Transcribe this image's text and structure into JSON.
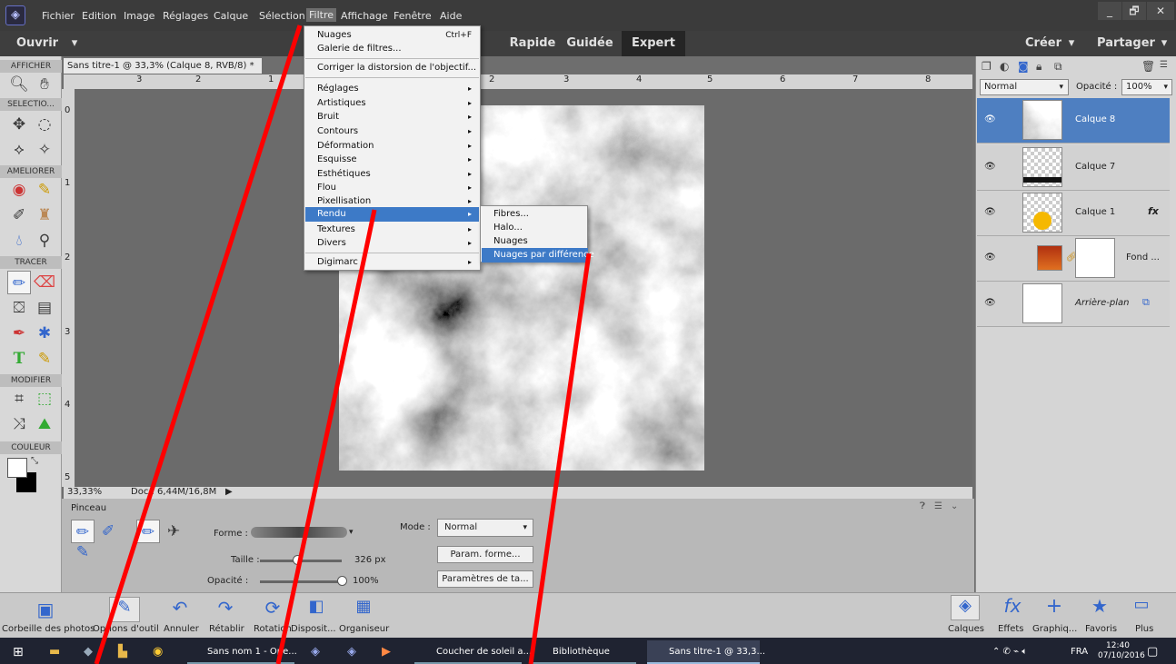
{
  "menubar": {
    "items": [
      "Fichier",
      "Edition",
      "Image",
      "Réglages",
      "Calque",
      "Sélection",
      "Filtre",
      "Affichage",
      "Fenêtre",
      "Aide"
    ],
    "selected": "Filtre",
    "window_controls": [
      "_",
      "🗗",
      "✕"
    ]
  },
  "modebar": {
    "open_label": "Ouvrir",
    "open_arrow": "▾",
    "modes": [
      "Rapide",
      "Guidée",
      "Expert"
    ],
    "active_mode": "Expert",
    "create_label": "Créer",
    "share_label": "Partager",
    "dropdown_arrow": "▾"
  },
  "toolbox": {
    "sections": [
      "AFFICHER",
      "SELECTIO...",
      "AMELIORER",
      "TRACER",
      "MODIFIER",
      "COULEUR"
    ]
  },
  "document": {
    "tab_title": "Sans titre-1 @ 33,3% (Calque 8, RVB/8) *",
    "tab_close": "×",
    "zoom": "33,33%",
    "doc_size": "Doc : 6,44M/16,8M",
    "ruler_h": [
      "3",
      "2",
      "1",
      "2",
      "3",
      "4",
      "5",
      "6",
      "7",
      "8"
    ],
    "ruler_v": [
      "0",
      "1",
      "2",
      "3",
      "4",
      "5"
    ]
  },
  "filter_menu": {
    "items": [
      {
        "label": "Nuages",
        "shortcut": "Ctrl+F"
      },
      {
        "label": "Galerie de filtres..."
      },
      {
        "label": "Corriger la distorsion de l'objectif..."
      },
      {
        "label": "Réglages",
        "sub": true
      },
      {
        "label": "Artistiques",
        "sub": true
      },
      {
        "label": "Bruit",
        "sub": true
      },
      {
        "label": "Contours",
        "sub": true
      },
      {
        "label": "Déformation",
        "sub": true
      },
      {
        "label": "Esquisse",
        "sub": true
      },
      {
        "label": "Esthétiques",
        "sub": true
      },
      {
        "label": "Flou",
        "sub": true
      },
      {
        "label": "Pixellisation",
        "sub": true
      },
      {
        "label": "Rendu",
        "sub": true,
        "highlighted": true
      },
      {
        "label": "Textures",
        "sub": true
      },
      {
        "label": "Divers",
        "sub": true
      },
      {
        "label": "Digimarc",
        "sub": true
      }
    ],
    "arrow": "▸",
    "highlighted": "Rendu"
  },
  "render_submenu": {
    "items": [
      "Fibres...",
      "Halo...",
      "Nuages",
      "Nuages par différence"
    ],
    "highlighted": "Nuages par différence"
  },
  "options": {
    "tool_name": "Pinceau",
    "forme_label": "Forme :",
    "mode_label": "Mode :",
    "mode_value": "Normal",
    "size_label": "Taille :",
    "size_value": "326 px",
    "size_level": 0.45,
    "opacity_label": "Opacité :",
    "opacity_value": "100%",
    "opacity_level": 1.0,
    "btn_brush_settings": "Param. forme...",
    "btn_tablet_settings": "Paramètres de ta..."
  },
  "layers_panel": {
    "blend_mode": "Normal",
    "opacity_label": "Opacité :",
    "opacity_value": "100%",
    "layers": [
      {
        "name": "Calque 8",
        "active": true
      },
      {
        "name": "Calque 7",
        "active": false
      },
      {
        "name": "Calque 1",
        "active": false,
        "fx": "fx"
      },
      {
        "name": "Fond ...",
        "active": false
      },
      {
        "name": "Arrière-plan",
        "active": false,
        "italic": true
      }
    ]
  },
  "bottombar": {
    "left": [
      "Corbeille des photos",
      "Options d'outil",
      "Annuler",
      "Rétablir",
      "Rotation",
      "Disposit...",
      "Organiseur"
    ],
    "right": [
      "Calques",
      "Effets",
      "Graphiq...",
      "Favoris",
      "Plus"
    ]
  },
  "taskbar": {
    "tasks": [
      "Sans nom 1 - Ope...",
      "Coucher de soleil a...",
      "Bibliothèque",
      "Sans titre-1 @ 33,3..."
    ],
    "lang": "FRA",
    "time": "12:40",
    "date": "07/10/2016"
  },
  "colors": {
    "accent": "#3d7ac7",
    "annotation_red": "#ff0000"
  }
}
